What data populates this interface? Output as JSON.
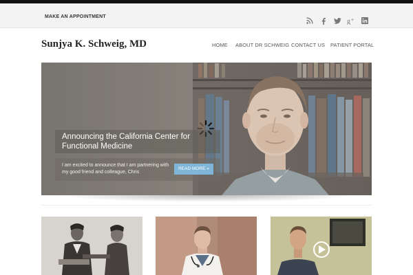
{
  "utility_bar": {
    "appointment_link": "MAKE AN APPOINTMENT",
    "social_icons": [
      "rss-icon",
      "facebook-icon",
      "twitter-icon",
      "google-plus-icon",
      "linkedin-icon"
    ]
  },
  "header": {
    "site_title": "Sunjya K. Schweig, MD",
    "nav": [
      "HOME",
      "ABOUT DR SCHWEIG",
      "CONTACT US",
      "PATIENT PORTAL"
    ]
  },
  "hero": {
    "headline": "Announcing the California Center for Functional Medicine",
    "excerpt": "I am excited to announce that I am partnering with my good friend and colleague, Chris",
    "read_more": "READ MORE »",
    "loading_icon": "spinner-icon"
  },
  "thumbnails": [
    {
      "image": "vintage-photo-two-men"
    },
    {
      "image": "doctor-with-stethoscope"
    },
    {
      "image": "video-with-play-icon"
    }
  ],
  "colors": {
    "utility_bg": "#f3f3f3",
    "accent_button": "#7fb6d8",
    "text_dark": "#222222"
  }
}
